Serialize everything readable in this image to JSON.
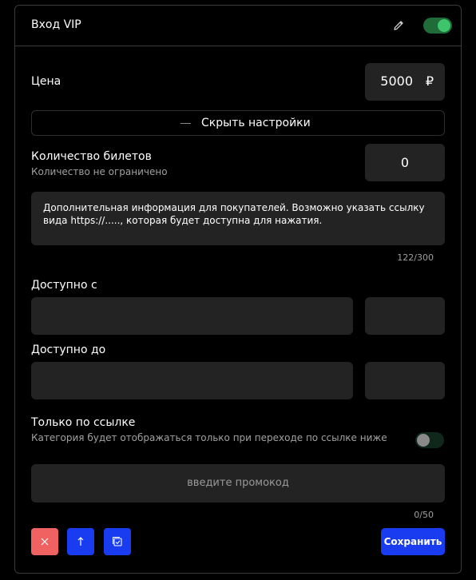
{
  "header": {
    "title": "Вход VIP"
  },
  "price": {
    "label": "Цена",
    "value": "5000",
    "currency": "₽"
  },
  "settings": {
    "hide_label": "Скрыть настройки"
  },
  "tickets": {
    "label": "Количество билетов",
    "hint": "Количество не ограничено",
    "value": "0"
  },
  "info": {
    "text": "Дополнительная информация для покупателей. Возможно указать ссылку вида https://....., которая будет доступна для нажатия.",
    "counter": "122/300"
  },
  "available_from": {
    "label": "Доступно с"
  },
  "available_to": {
    "label": "Доступно до"
  },
  "link_only": {
    "label": "Только по ссылке",
    "hint": "Категория будет отображаться только при переходе по ссылке ниже"
  },
  "promo": {
    "placeholder": "введите промокод",
    "counter": "0/50"
  },
  "actions": {
    "save_label": "Сохранить"
  },
  "colors": {
    "accent": "#1a3cf0",
    "danger": "#f06262",
    "toggle_on": "#3ec46a",
    "field_bg": "#232323"
  },
  "icons": [
    "pencil-icon",
    "close-icon",
    "arrow-up-icon",
    "copy-check-icon",
    "minus-icon"
  ]
}
